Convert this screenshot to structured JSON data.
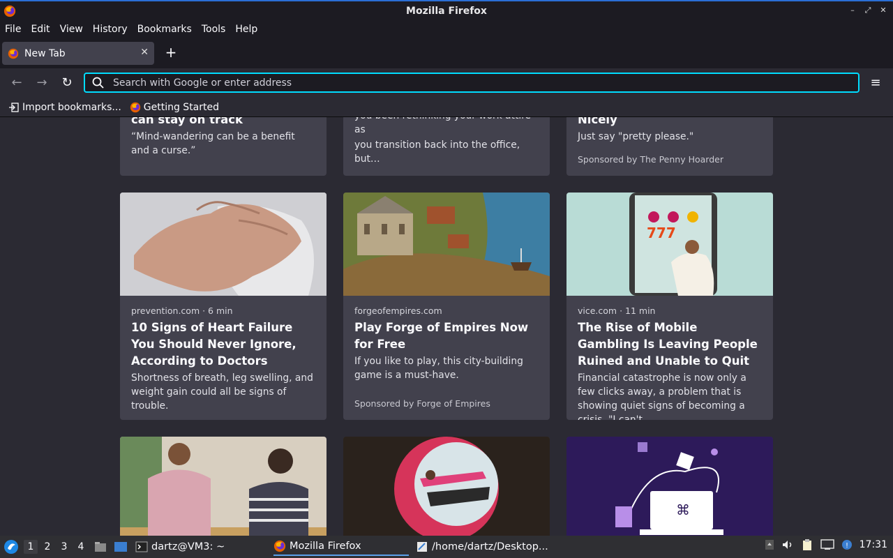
{
  "window": {
    "title": "Mozilla Firefox",
    "controls": [
      "–",
      "⤢",
      "✕"
    ]
  },
  "menubar": {
    "items": [
      "File",
      "Edit",
      "View",
      "History",
      "Bookmarks",
      "Tools",
      "Help"
    ]
  },
  "tabs": [
    {
      "label": "New Tab",
      "close": "✕"
    }
  ],
  "newtab": {
    "label": "+"
  },
  "navbar": {
    "back": "←",
    "forward": "→",
    "reload": "↻",
    "search_placeholder": "Search with Google or enter address",
    "menu": "≡"
  },
  "bookmarks": {
    "items": [
      {
        "label": "Import bookmarks..."
      },
      {
        "label": "Getting Started"
      }
    ]
  },
  "cards_top": [
    {
      "headline": "can stay on track",
      "excerpt": "“Mind-wandering can be a benefit and a curse.”"
    },
    {
      "excerpt_line1": "you been rethinking your work attire as",
      "excerpt_line2": "you transition back into the office, but…"
    },
    {
      "headline": "Nicely",
      "excerpt": "Just say \"pretty please.\"",
      "sponsor": "Sponsored by The Penny Hoarder"
    }
  ],
  "cards_mid": [
    {
      "source": "prevention.com · 6 min",
      "headline": "10 Signs of Heart Failure You Should Never Ignore, According to Doctors",
      "excerpt": "Shortness of breath, leg swelling, and weight gain could all be signs of trouble."
    },
    {
      "source": "forgeofempires.com",
      "headline": "Play Forge of Empires Now for Free",
      "excerpt": "If you like to play, this city-building game is a must-have.",
      "sponsor": "Sponsored by Forge of Empires"
    },
    {
      "source": "vice.com · 11 min",
      "headline": "The Rise of Mobile Gambling Is Leaving People Ruined and Unable to Quit",
      "excerpt": "Financial catastrophe is now only a few clicks away, a problem that is showing quiet signs of becoming a crisis. \"I can't…"
    }
  ],
  "taskbar": {
    "workspaces": [
      "1",
      "2",
      "3",
      "4"
    ],
    "apps": [
      {
        "label": "dartz@VM3: ~"
      },
      {
        "label": "Mozilla Firefox"
      },
      {
        "label": "/home/dartz/Desktop..."
      }
    ],
    "clock": "17:31"
  }
}
